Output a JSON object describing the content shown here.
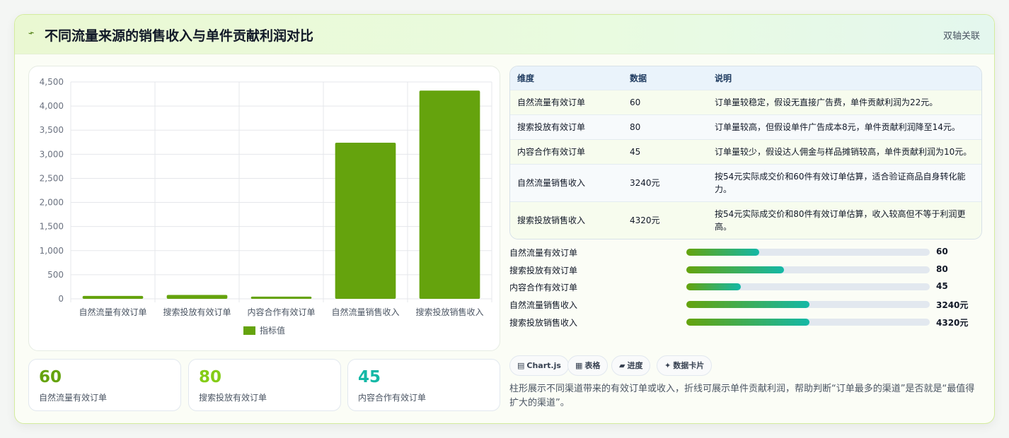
{
  "header": {
    "icon": "lightning-icon",
    "title": "不同流量来源的销售收入与单件贡献利润对比",
    "badge": "双轴关联"
  },
  "chart_data": {
    "type": "bar",
    "categories": [
      "自然流量有效订单",
      "搜索投放有效订单",
      "内容合作有效订单",
      "自然流量销售收入",
      "搜索投放销售收入"
    ],
    "series": [
      {
        "name": "指标值",
        "values": [
          60,
          80,
          45,
          3240,
          4320
        ],
        "color": "#65a30d"
      }
    ],
    "ylim": [
      0,
      4500
    ],
    "yticks": [
      0,
      500,
      1000,
      1500,
      2000,
      2500,
      3000,
      3500,
      4000,
      4500
    ],
    "ytick_labels": [
      "0",
      "500",
      "1,000",
      "1,500",
      "2,000",
      "2,500",
      "3,000",
      "3,500",
      "4,000",
      "4,500"
    ],
    "grid": true,
    "legend": "bottom"
  },
  "stats": [
    {
      "value": "60",
      "label": "自然流量有效订单",
      "color": "#65a30d"
    },
    {
      "value": "80",
      "label": "搜索投放有效订单",
      "color": "#84cc16"
    },
    {
      "value": "45",
      "label": "内容合作有效订单",
      "color": "#14b8a6"
    }
  ],
  "table": {
    "headers": [
      "维度",
      "数据",
      "说明"
    ],
    "rows": [
      [
        "自然流量有效订单",
        "60",
        "订单量较稳定，假设无直接广告费，单件贡献利润为22元。"
      ],
      [
        "搜索投放有效订单",
        "80",
        "订单量较高，但假设单件广告成本8元，单件贡献利润降至14元。"
      ],
      [
        "内容合作有效订单",
        "45",
        "订单量较少，假设达人佣金与样品摊销较高，单件贡献利润为10元。"
      ],
      [
        "自然流量销售收入",
        "3240元",
        "按54元实际成交价和60件有效订单估算，适合验证商品自身转化能力。"
      ],
      [
        "搜索投放销售收入",
        "4320元",
        "按54元实际成交价和80件有效订单估算，收入较高但不等于利润更高。"
      ]
    ]
  },
  "progress": [
    {
      "label": "自然流量有效订单",
      "value": "60",
      "fraction": 0.3
    },
    {
      "label": "搜索投放有效订单",
      "value": "80",
      "fraction": 0.4
    },
    {
      "label": "内容合作有效订单",
      "value": "45",
      "fraction": 0.225
    },
    {
      "label": "自然流量销售收入",
      "value": "3240元",
      "fraction": 0.505
    },
    {
      "label": "搜索投放销售收入",
      "value": "4320元",
      "fraction": 0.505
    }
  ],
  "chips": [
    {
      "icon": "chart-icon",
      "glyph": "▤",
      "label": "Chart.js"
    },
    {
      "icon": "table-icon",
      "glyph": "▦",
      "label": "表格"
    },
    {
      "icon": "progress-icon",
      "glyph": "▰",
      "label": "进度"
    },
    {
      "icon": "sparkle-icon",
      "glyph": "✦",
      "label": "数据卡片"
    }
  ],
  "footnote": "柱形展示不同渠道带来的有效订单或收入，折线可展示单件贡献利润，帮助判断“订单最多的渠道”是否就是“最值得扩大的渠道”。"
}
